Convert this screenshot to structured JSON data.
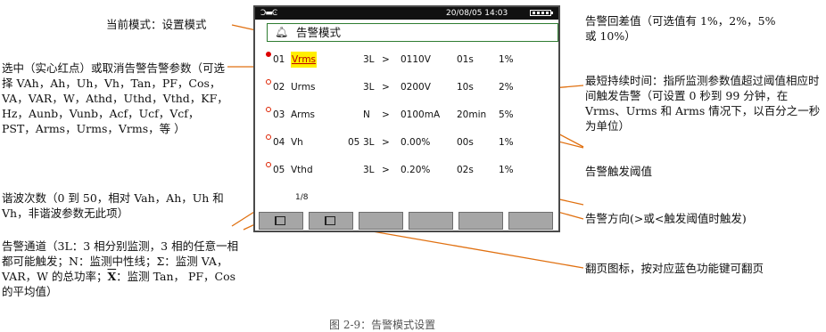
{
  "annotations": {
    "current_mode": "当前模式：设置模式",
    "select_alarm": "选中（实心红点）或取消告警告警参数（可选择 VAh，Ah，Uh，Vh，Tan，PF，Cos，VA，VAR，W，Athd，Uthd，Vthd，KF，Hz，Aunb，Vunb，Acf，Ucf，Vcf，PST，Arms，Urms，Vrms，等 ）",
    "harmonic_order": "谐波次数（0 到 50，相对 Vah，Ah，Uh 和 Vh，非谐波参数无此项）",
    "channel_a": "告警通道（3L：3 相分别监测，3 相的任意一相都可能触发；N：监测中性线；Σ：监测 VA，VAR，W 的总功率；",
    "channel_xbar": "X",
    "channel_b": "：监测 Tan， PF，Cos 的平均值）",
    "hysteresis": "告警回差值（可选值有 1%，2%，5%或 10%）",
    "min_duration": "最短持续时间：指所监测参数值超过阈值相应时间触发告警（可设置 0 秒到 99 分钟，在 Vrms、Urms 和 Arms 情况下，以百分之一秒为单位）",
    "threshold": "告警触发阈值",
    "direction": "告警方向(>或<触发阈值时触发)",
    "page_icon": "翻页图标，按对应蓝色功能键可翻页",
    "figure_caption": "图 2-9：告警模式设置"
  },
  "screen": {
    "status_icon": "Ͻ▬Ͼ",
    "datetime": "20/08/05  14:03",
    "battery_icon": "battery-icon",
    "title_icon": "bell-icon",
    "title": "告警模式",
    "pager": "1/8",
    "rows": [
      {
        "no": "01",
        "param": "Vrms",
        "harm": "",
        "ch": "3L",
        "dir": ">",
        "threshold": "0110V",
        "duration": "01s",
        "hyst": "1%",
        "active": true
      },
      {
        "no": "02",
        "param": "Urms",
        "harm": "",
        "ch": "3L",
        "dir": ">",
        "threshold": "0200V",
        "duration": "10s",
        "hyst": "2%",
        "active": false
      },
      {
        "no": "03",
        "param": "Arms",
        "harm": "",
        "ch": "N",
        "dir": ">",
        "threshold": "0100mA",
        "duration": "20min",
        "hyst": "5%",
        "active": false
      },
      {
        "no": "04",
        "param": "Vh",
        "harm": "05",
        "ch": "3L",
        "dir": ">",
        "threshold": "0.00%",
        "duration": "00s",
        "hyst": "1%",
        "active": false
      },
      {
        "no": "05",
        "param": "Vthd",
        "harm": "",
        "ch": "3L",
        "dir": ">",
        "threshold": "0.20%",
        "duration": "02s",
        "hyst": "1%",
        "active": false
      }
    ],
    "function_keys": [
      "page-back-icon",
      "page-forward-icon",
      "",
      "",
      "",
      ""
    ]
  },
  "colors": {
    "leader_line": "#e07010",
    "title_border": "#2f7d32",
    "selected_bg": "#ffee00",
    "active_dot": "#dd0000"
  }
}
